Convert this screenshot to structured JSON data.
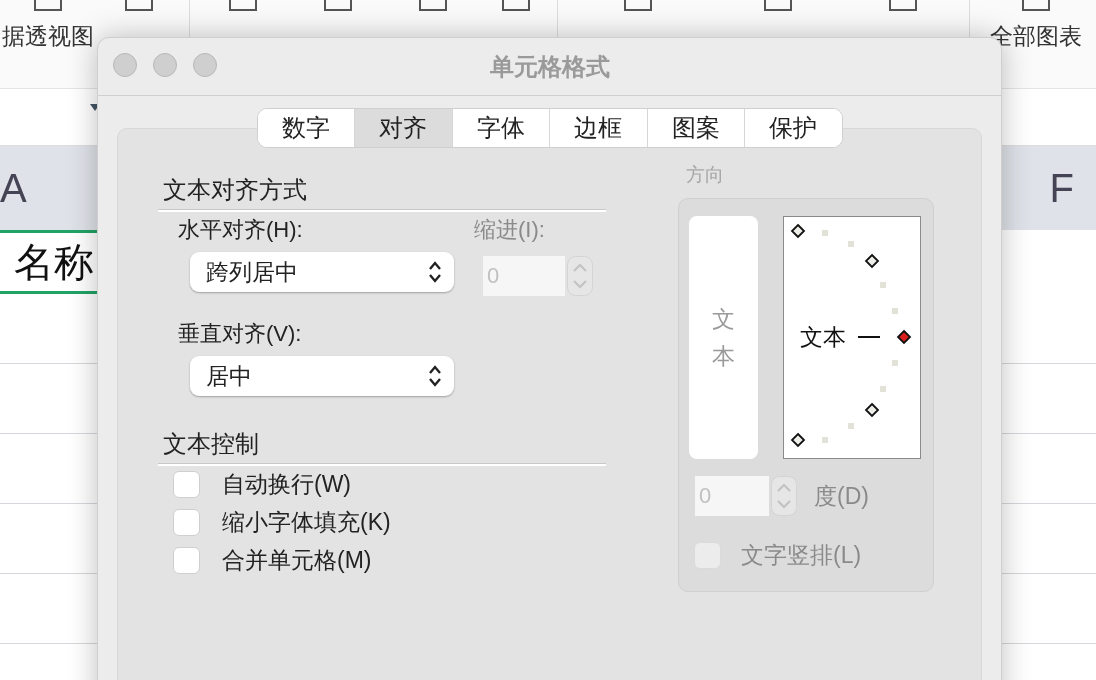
{
  "toolbar": {
    "labels": [
      "据透视图",
      "全部图表"
    ]
  },
  "sheet": {
    "column_headers": [
      "A",
      "F"
    ],
    "cell_text": "名称"
  },
  "dialog": {
    "title": "单元格格式",
    "tabs": [
      {
        "label": "数字",
        "selected": false
      },
      {
        "label": "对齐",
        "selected": true
      },
      {
        "label": "字体",
        "selected": false
      },
      {
        "label": "边框",
        "selected": false
      },
      {
        "label": "图案",
        "selected": false
      },
      {
        "label": "保护",
        "selected": false
      }
    ],
    "text_alignment": {
      "heading": "文本对齐方式",
      "horizontal": {
        "label": "水平对齐(H):",
        "value": "跨列居中"
      },
      "indent": {
        "label": "缩进(I):",
        "value": "0",
        "disabled": true
      },
      "vertical": {
        "label": "垂直对齐(V):",
        "value": "居中"
      }
    },
    "text_control": {
      "heading": "文本控制",
      "options": [
        {
          "label": "自动换行(W)",
          "checked": false
        },
        {
          "label": "缩小字体填充(K)",
          "checked": false
        },
        {
          "label": "合并单元格(M)",
          "checked": false
        }
      ]
    },
    "orientation": {
      "heading": "方向",
      "vertical_text": "文本",
      "dial_text": "文本",
      "points": [
        {
          "selected": false
        },
        {
          "selected": false
        },
        {
          "selected": true
        },
        {
          "selected": false
        },
        {
          "selected": false
        }
      ],
      "degrees": {
        "value": "0",
        "label": "度(D)",
        "disabled": true
      },
      "vertical_stacking": {
        "label": "文字竖排(L)",
        "checked": false,
        "disabled": true
      }
    }
  }
}
